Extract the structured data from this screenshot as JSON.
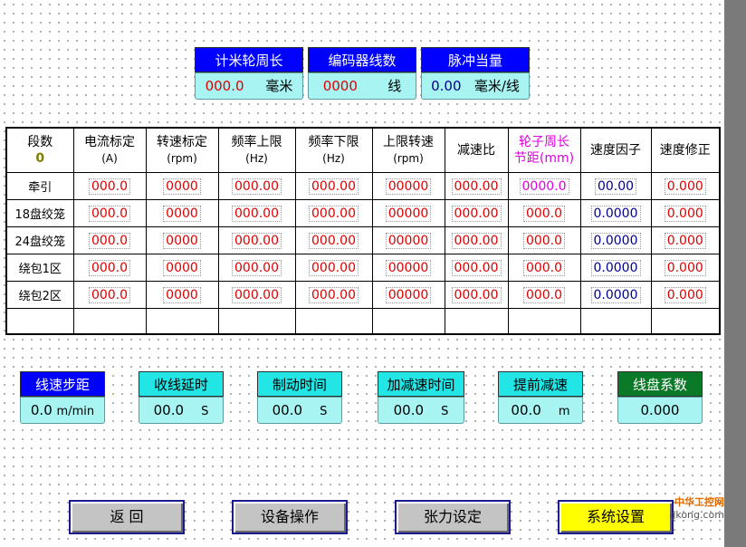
{
  "top_params": [
    {
      "title": "计米轮周长",
      "value": "000.0",
      "unit": "毫米"
    },
    {
      "title": "编码器线数",
      "value": "0000",
      "unit": "线"
    },
    {
      "title": "脉冲当量",
      "value": "0.00",
      "unit": "毫米/线"
    }
  ],
  "table": {
    "headers": [
      {
        "line1": "段数",
        "line2": "0"
      },
      {
        "line1": "电流标定",
        "line2": "(A)"
      },
      {
        "line1": "转速标定",
        "line2": "(rpm)"
      },
      {
        "line1": "频率上限",
        "line2": "(Hz)"
      },
      {
        "line1": "频率下限",
        "line2": "(Hz)"
      },
      {
        "line1": "上限转速",
        "line2": "(rpm)"
      },
      {
        "line1": "减速比",
        "line2": ""
      },
      {
        "line1": "轮子周长",
        "line2": "节距(mm)"
      },
      {
        "line1": "速度因子",
        "line2": ""
      },
      {
        "line1": "速度修正",
        "line2": ""
      }
    ],
    "rows": [
      {
        "name": "牵引",
        "cells": [
          "000.0",
          "0000",
          "000.00",
          "000.00",
          "00000",
          "000.00",
          "0000.0",
          "00.00",
          "0.000"
        ]
      },
      {
        "name": "18盘绞笼",
        "cells": [
          "000.0",
          "0000",
          "000.00",
          "000.00",
          "00000",
          "000.00",
          "000.0",
          "0.0000",
          "0.000"
        ]
      },
      {
        "name": "24盘绞笼",
        "cells": [
          "000.0",
          "0000",
          "000.00",
          "000.00",
          "00000",
          "000.00",
          "000.0",
          "0.0000",
          "0.000"
        ]
      },
      {
        "name": "绕包1区",
        "cells": [
          "000.0",
          "0000",
          "000.00",
          "000.00",
          "00000",
          "000.00",
          "000.0",
          "0.0000",
          "0.000"
        ]
      },
      {
        "name": "绕包2区",
        "cells": [
          "000.0",
          "0000",
          "000.00",
          "000.00",
          "00000",
          "000.00",
          "000.0",
          "0.0000",
          "0.000"
        ]
      },
      {
        "name": "",
        "cells": [
          "",
          "",
          "",
          "",
          "",
          "",
          "",
          "",
          ""
        ]
      }
    ]
  },
  "bottom_params": [
    {
      "title": "线速步距",
      "value": "0.0",
      "unit": "m/min"
    },
    {
      "title": "收线延时",
      "value": "00.0",
      "unit": "S"
    },
    {
      "title": "制动时间",
      "value": "00.0",
      "unit": "S"
    },
    {
      "title": "加减速时间",
      "value": "00.0",
      "unit": "S"
    },
    {
      "title": "提前减速",
      "value": "00.0",
      "unit": "m"
    },
    {
      "title": "线盘系数",
      "value": "0.000",
      "unit": ""
    }
  ],
  "buttons": {
    "back": "返  回",
    "device": "设备操作",
    "tension": "张力设定",
    "system": "系统设置"
  },
  "watermark": {
    "text": "中华工控网",
    "site": "gkong.com"
  }
}
